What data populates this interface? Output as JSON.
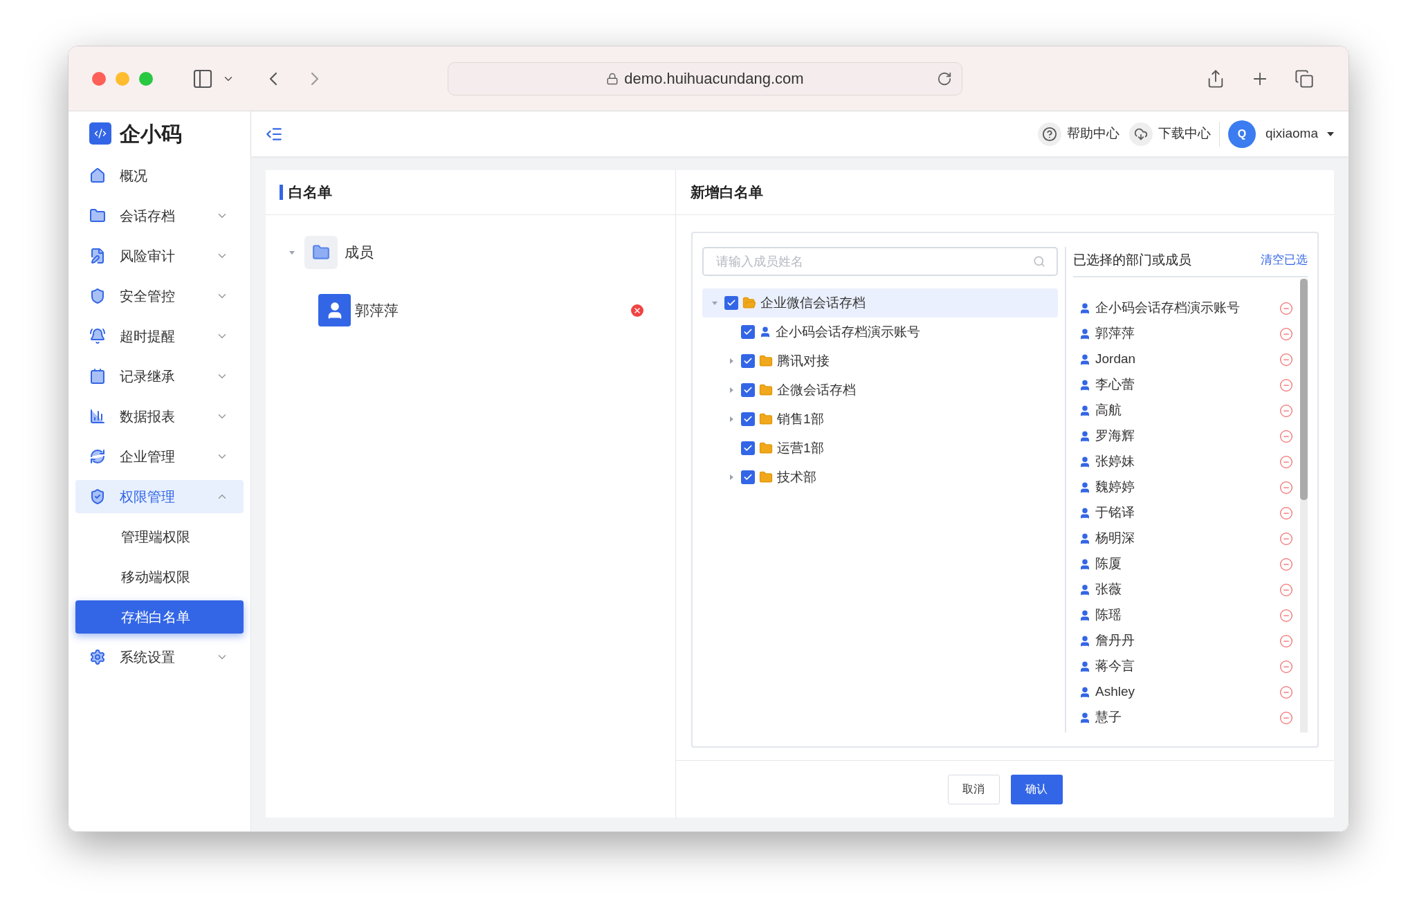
{
  "browser": {
    "url": "demo.huihuacundang.com"
  },
  "sidebar": {
    "logo": "企小码",
    "items": [
      {
        "label": "概况",
        "selected": false
      },
      {
        "label": "会话存档",
        "selected": false,
        "expanded": false
      },
      {
        "label": "风险审计",
        "selected": false,
        "expanded": false
      },
      {
        "label": "安全管控",
        "selected": false,
        "expanded": false
      },
      {
        "label": "超时提醒",
        "selected": false,
        "expanded": false
      },
      {
        "label": "记录继承",
        "selected": false,
        "expanded": false
      },
      {
        "label": "数据报表",
        "selected": false,
        "expanded": false
      },
      {
        "label": "企业管理",
        "selected": false,
        "expanded": false
      },
      {
        "label": "权限管理",
        "selected": true,
        "expanded": true,
        "children": [
          {
            "label": "管理端权限",
            "selected": false
          },
          {
            "label": "移动端权限",
            "selected": false
          },
          {
            "label": "存档白名单",
            "selected": true
          }
        ]
      },
      {
        "label": "系统设置",
        "selected": false,
        "expanded": false
      }
    ]
  },
  "header": {
    "help": "帮助中心",
    "download": "下载中心",
    "user": {
      "initial": "Q",
      "name": "qixiaoma"
    }
  },
  "whitelist": {
    "title": "白名单",
    "group": {
      "label": "成员",
      "expanded": true,
      "members": [
        {
          "name": "郭萍萍"
        }
      ]
    }
  },
  "add_panel": {
    "title": "新增白名单",
    "search": {
      "placeholder": "请输入成员姓名"
    },
    "tree": [
      {
        "kind": "folder",
        "label": "企业微信会话存档",
        "checked": true,
        "selected": true,
        "expanded": true,
        "children": [
          {
            "kind": "member",
            "label": "企小码会话存档演示账号",
            "checked": true,
            "selected": false
          },
          {
            "kind": "folder",
            "label": "腾讯对接",
            "checked": true,
            "selected": false,
            "expanded": false
          },
          {
            "kind": "folder",
            "label": "企微会话存档",
            "checked": true,
            "selected": false,
            "expanded": false
          },
          {
            "kind": "folder",
            "label": "销售1部",
            "checked": true,
            "selected": false,
            "expanded": false
          },
          {
            "kind": "folder",
            "label": "运营1部",
            "checked": true,
            "selected": false
          },
          {
            "kind": "folder",
            "label": "技术部",
            "checked": true,
            "selected": false,
            "expanded": false
          }
        ]
      }
    ],
    "selected_title": "已选择的部门或成员",
    "clear": "清空已选",
    "selected": [
      "企小码会话存档演示账号",
      "郭萍萍",
      "Jordan",
      "李心蕾",
      "高航",
      "罗海辉",
      "张婷妹",
      "魏婷婷",
      "于铭译",
      "杨明深",
      "陈厦",
      "张薇",
      "陈瑶",
      "詹丹丹",
      "蒋今言",
      "Ashley",
      "慧子"
    ],
    "buttons": {
      "cancel": "取消",
      "confirm": "确认"
    }
  }
}
